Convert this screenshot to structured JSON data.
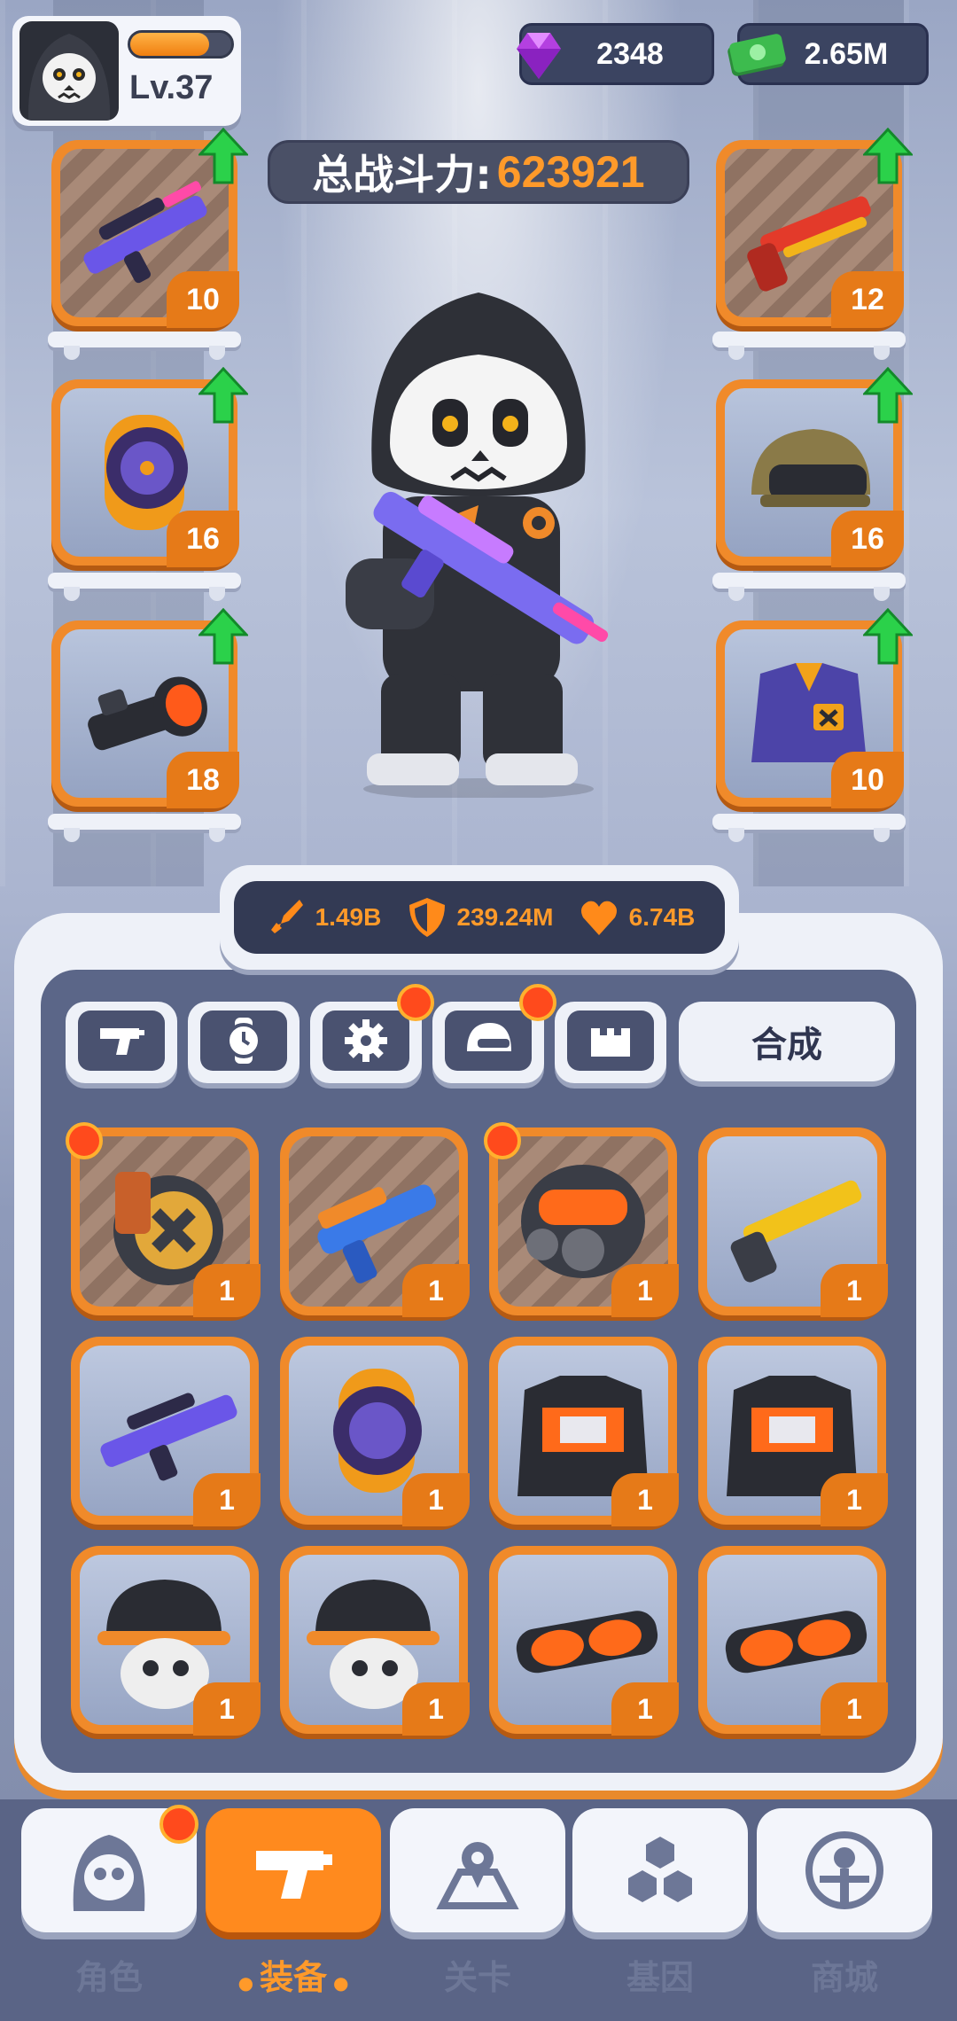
{
  "player": {
    "level": "Lv.37",
    "xp_fraction": 0.78
  },
  "currency": {
    "gems": "2348",
    "cash": "2.65M"
  },
  "power": {
    "label": "总战斗力:",
    "value": "623921"
  },
  "equipped_left": [
    {
      "name": "purple-sniper-rifle",
      "level": "10",
      "upgradable": true
    },
    {
      "name": "purple-orange-watch",
      "level": "16",
      "upgradable": true
    },
    {
      "name": "scope",
      "level": "18",
      "upgradable": true
    }
  ],
  "equipped_right": [
    {
      "name": "red-shotgun",
      "level": "12",
      "upgradable": true
    },
    {
      "name": "military-helmet",
      "level": "16",
      "upgradable": true
    },
    {
      "name": "purple-jacket",
      "level": "10",
      "upgradable": true
    }
  ],
  "stats": {
    "attack": "1.49B",
    "defense": "239.24M",
    "health": "6.74B"
  },
  "tabs": [
    "gun-tab",
    "watch-tab",
    "gear-tab",
    "helmet-tab",
    "armor-tab"
  ],
  "combine_label": "合成",
  "inventory": [
    {
      "name": "ammo-drum",
      "count": "1"
    },
    {
      "name": "blue-pistol",
      "count": "1"
    },
    {
      "name": "gas-mask",
      "count": "1"
    },
    {
      "name": "gold-shotgun",
      "count": "1"
    },
    {
      "name": "purple-rifle",
      "count": "1"
    },
    {
      "name": "watch",
      "count": "1"
    },
    {
      "name": "jacket",
      "count": "1"
    },
    {
      "name": "jacket",
      "count": "1"
    },
    {
      "name": "skull-cap",
      "count": "1"
    },
    {
      "name": "skull-cap",
      "count": "1"
    },
    {
      "name": "goggles",
      "count": "1"
    },
    {
      "name": "goggles",
      "count": "1"
    }
  ],
  "nav": [
    {
      "label": "角色",
      "icon": "character-icon"
    },
    {
      "label": "装备",
      "icon": "equipment-icon"
    },
    {
      "label": "关卡",
      "icon": "map-icon"
    },
    {
      "label": "基因",
      "icon": "gene-icon"
    },
    {
      "label": "商城",
      "icon": "shop-icon"
    }
  ],
  "colors": {
    "accent": "#f08a2a",
    "panel": "#5b6688",
    "badge": "#ff4a1c",
    "upgrade": "#2bd14a"
  }
}
